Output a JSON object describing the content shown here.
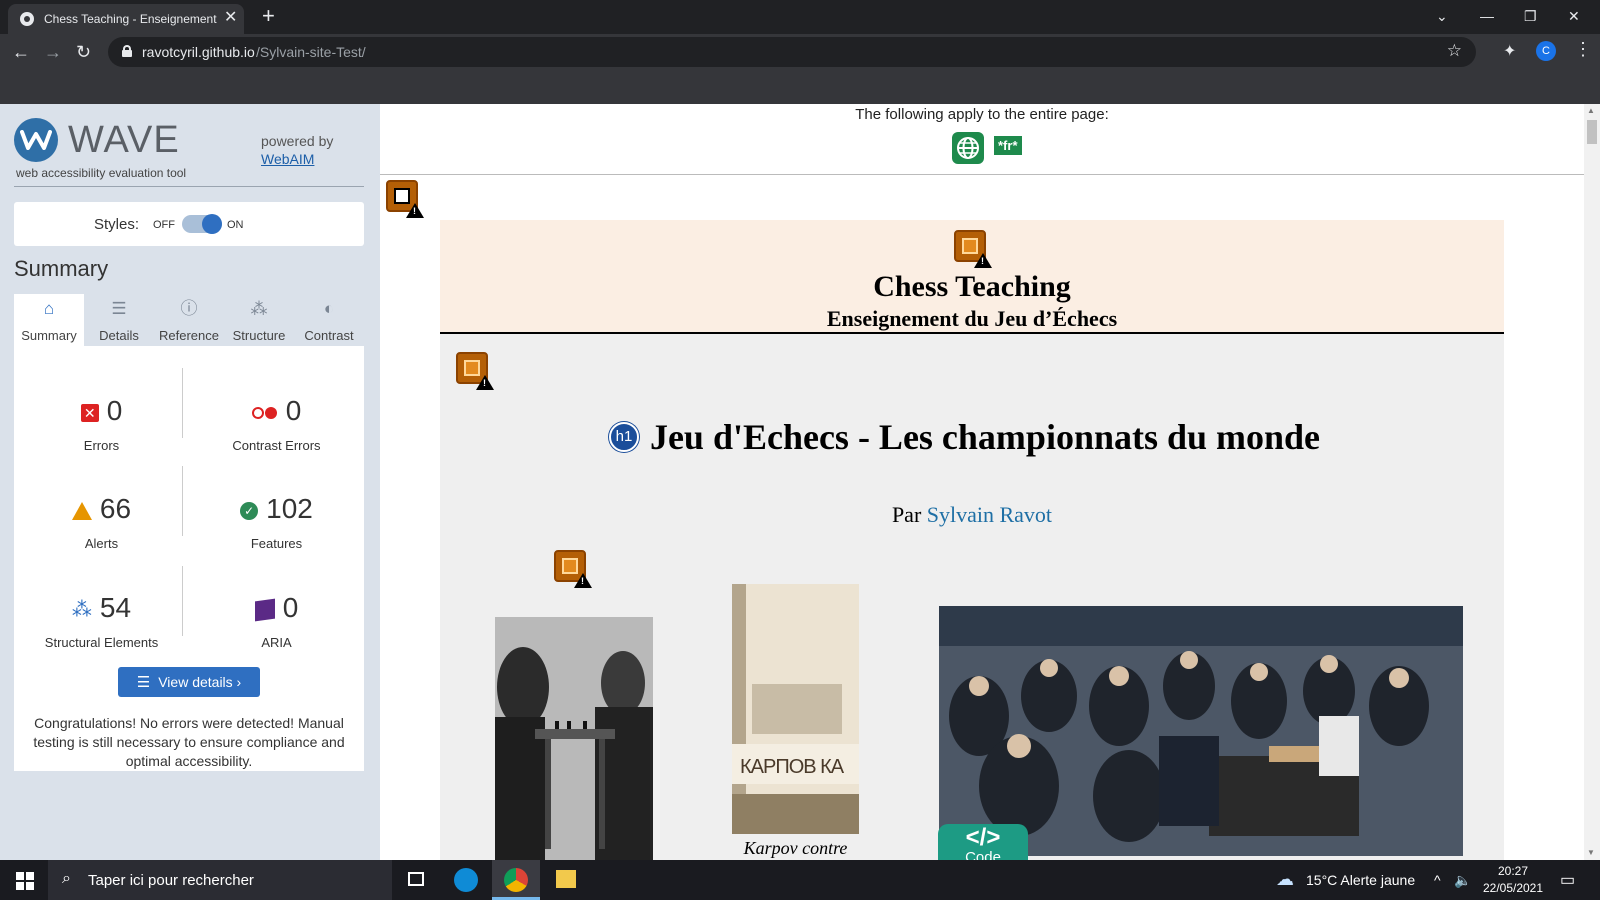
{
  "browser": {
    "tab_title": "Chess Teaching - Enseignement du Jeu d'Échecs",
    "tab_close": "✕",
    "new_tab": "+",
    "url_host": "ravotcyril.github.io",
    "url_path": "/Sylvain-site-Test/",
    "profile_initial": "C"
  },
  "wave": {
    "logo_text": "WAVE",
    "tagline": "web accessibility evaluation tool",
    "powered_by": "powered by",
    "webaim_link": "WebAIM",
    "styles_label": "Styles:",
    "toggle_off": "OFF",
    "toggle_on": "ON",
    "styles_on": true,
    "summary_heading": "Summary",
    "tabs": [
      {
        "label": "Summary",
        "icon": "home-icon",
        "active": true
      },
      {
        "label": "Details",
        "icon": "list-icon",
        "active": false
      },
      {
        "label": "Reference",
        "icon": "info-icon",
        "active": false
      },
      {
        "label": "Structure",
        "icon": "structure-icon",
        "active": false
      },
      {
        "label": "Contrast",
        "icon": "contrast-icon",
        "active": false
      }
    ],
    "stats": {
      "errors": {
        "count": "0",
        "label": "Errors"
      },
      "contrast_errors": {
        "count": "0",
        "label": "Contrast Errors"
      },
      "alerts": {
        "count": "66",
        "label": "Alerts"
      },
      "features": {
        "count": "102",
        "label": "Features"
      },
      "structural": {
        "count": "54",
        "label": "Structural Elements"
      },
      "aria": {
        "count": "0",
        "label": "ARIA"
      }
    },
    "view_details": "View details ›",
    "congrats": "Congratulations! No errors were detected! Manual testing is still necessary to ensure compliance and optimal accessibility."
  },
  "page": {
    "apply_text": "The following apply to the entire page:",
    "lang_badge": "*fr*",
    "site_title": "Chess Teaching",
    "site_subtitle": "Enseignement du Jeu d’Échecs",
    "h1_badge": "h1",
    "heading": "Jeu d'Echecs - Les championnats du monde",
    "byline_prefix": "Par ",
    "byline_author": "Sylvain Ravot",
    "photo2_text": "КАРПОВ   КА",
    "caption2": "Karpov contre",
    "code_glyph": "</>",
    "code_label": "Code"
  },
  "taskbar": {
    "search_placeholder": "Taper ici pour rechercher",
    "weather": "15°C  Alerte jaune",
    "time": "20:27",
    "date": "22/05/2021"
  },
  "colors": {
    "wave_blue": "#2f6fc1",
    "error_red": "#d22",
    "alert_orange": "#e69500",
    "feature_green": "#2e8b57",
    "aria_purple": "#5b2a86",
    "header_band": "#fbeee3",
    "link_blue": "#1e6fa5"
  }
}
